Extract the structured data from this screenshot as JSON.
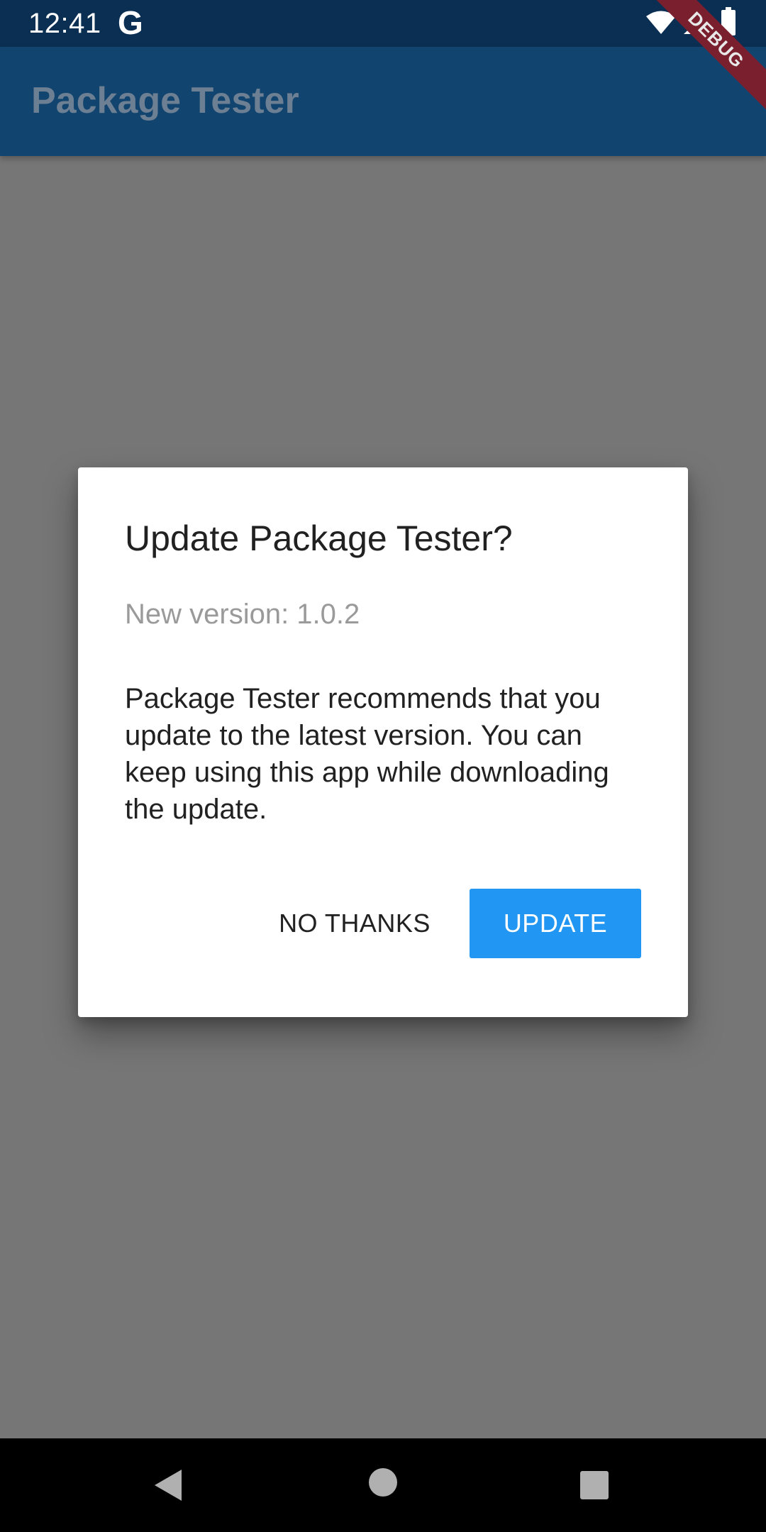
{
  "status_bar": {
    "time": "12:41",
    "google_glyph": "G",
    "icons": [
      "wifi-icon",
      "signal-icon",
      "battery-icon"
    ]
  },
  "app_bar": {
    "title": "Package Tester"
  },
  "debug_banner": {
    "label": "DEBUG"
  },
  "dialog": {
    "title": "Update Package Tester?",
    "version_text": "New version: 1.0.2",
    "message": "Package Tester recommends that you update to the latest version. You can keep using this app while downloading the update.",
    "buttons": {
      "no_thanks": "NO THANKS",
      "update": "UPDATE"
    }
  },
  "nav_bar": {
    "icons": [
      "back-icon",
      "home-icon",
      "recents-icon"
    ]
  },
  "colors": {
    "status_bar": "#0b2f53",
    "app_bar": "#11446e",
    "scrim_background": "#767676",
    "dialog_background": "#ffffff",
    "update_button": "#2196f3",
    "debug_banner": "#7a1f2e",
    "nav_bar": "#000000"
  }
}
